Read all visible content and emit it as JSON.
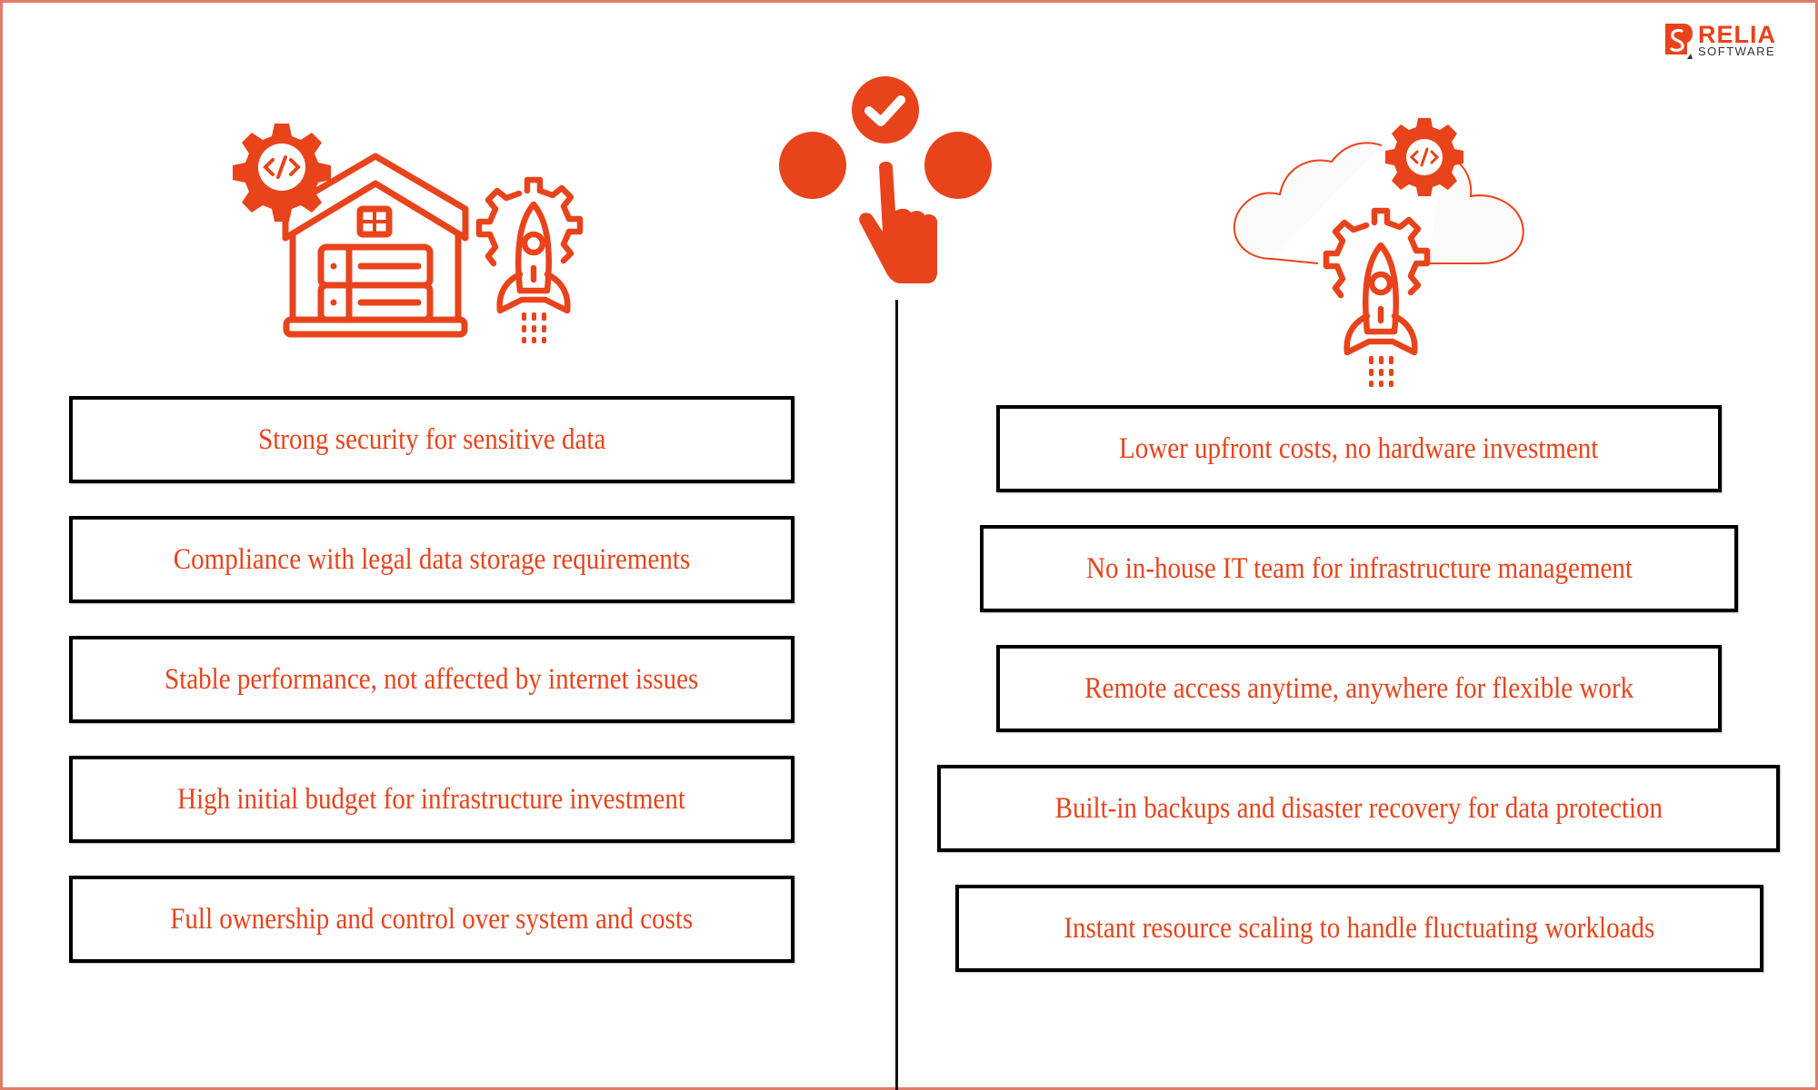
{
  "brand": {
    "name": "RELIA",
    "sub": "SOFTWARE",
    "accent": "#e8431b",
    "frame_color": "#e07b68"
  },
  "icons": {
    "left": "on-premise-house-server-rocket-gear-icon",
    "center": "hand-selecting-option-check-icon",
    "right": "cloud-rocket-gear-icon"
  },
  "left_column": {
    "items": [
      {
        "label": "Strong security for sensitive data"
      },
      {
        "label": "Compliance with legal data storage requirements"
      },
      {
        "label": "Stable performance, not affected by internet issues"
      },
      {
        "label": "High initial budget for infrastructure investment"
      },
      {
        "label": "Full ownership and control over system and costs"
      }
    ]
  },
  "right_column": {
    "items": [
      {
        "label": "Lower upfront costs, no hardware investment"
      },
      {
        "label": "No in-house IT team for infrastructure management"
      },
      {
        "label": "Remote access anytime, anywhere for flexible work"
      },
      {
        "label": "Built-in backups and disaster recovery for data protection"
      },
      {
        "label": "Instant resource scaling to handle fluctuating workloads"
      }
    ]
  }
}
